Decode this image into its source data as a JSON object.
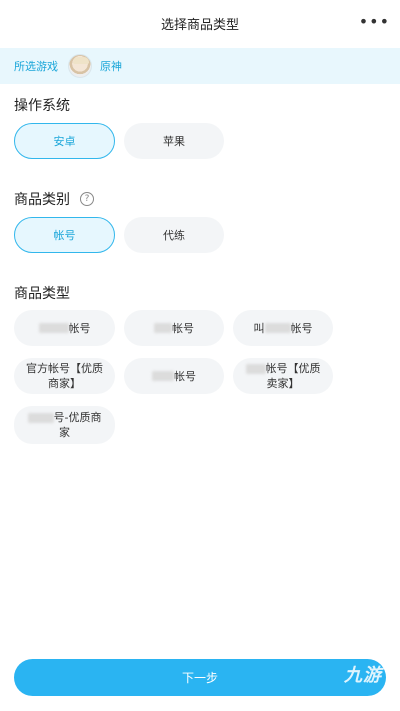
{
  "header": {
    "title": "选择商品类型",
    "more_icon": "more-dots-icon",
    "more_glyph": "•••"
  },
  "selected_game": {
    "label": "所选游戏",
    "name": "原神"
  },
  "os_section": {
    "title": "操作系统",
    "options": [
      "安卓",
      "苹果"
    ],
    "selected": "安卓"
  },
  "category_section": {
    "title": "商品类别",
    "help_glyph": "?",
    "options": [
      "帐号",
      "代练"
    ],
    "selected": "帐号"
  },
  "type_section": {
    "title": "商品类型",
    "options": [
      {
        "suffix": "帐号"
      },
      {
        "suffix": "帐号"
      },
      {
        "prefix": "叫",
        "suffix": "帐号"
      },
      {
        "line1": "官方帐号【优质",
        "line2": "商家】"
      },
      {
        "suffix": "帐号"
      },
      {
        "line1_suffix": "帐号【优质",
        "line2": "卖家】"
      },
      {
        "line1_suffix": "号-优质商",
        "line2": "家"
      }
    ]
  },
  "footer": {
    "next_label": "下一步",
    "watermark": "九游"
  },
  "colors": {
    "accent": "#2ab4f2",
    "accent_text": "#1aa6d9",
    "selected_bg": "#e6f7fe",
    "pill_bg": "#f3f5f7"
  }
}
